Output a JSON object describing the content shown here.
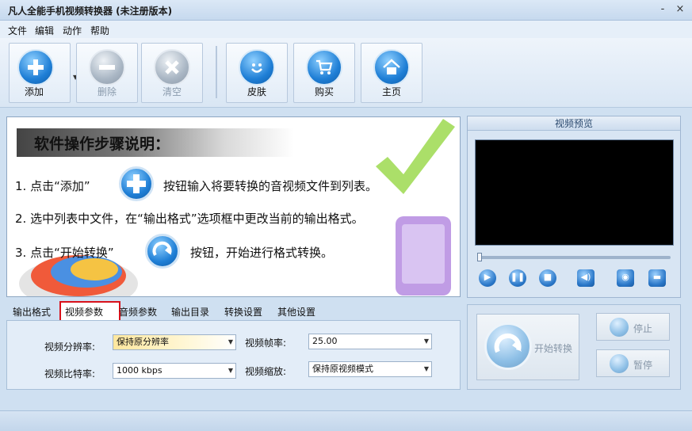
{
  "window": {
    "title": "凡人全能手机视频转换器  (未注册版本)",
    "minimize_glyph": "-",
    "close_glyph": "×"
  },
  "menu": [
    "文件",
    "编辑",
    "动作",
    "帮助"
  ],
  "toolbar": {
    "add": "添加",
    "delete": "删除",
    "clear": "清空",
    "skin": "皮肤",
    "buy": "购买",
    "home": "主页"
  },
  "banner": {
    "heading": "软件操作步骤说明：",
    "step1_a": "1. 点击“添加”",
    "step1_b": "按钮输入将要转换的音视频文件到列表。",
    "step2": "2. 选中列表中文件，在“输出格式”选项框中更改当前的输出格式。",
    "step3_a": "3. 点击“开始转换”",
    "step3_b": "按钮，开始进行格式转换。"
  },
  "preview": {
    "title": "视频预览"
  },
  "tabs": [
    "输出格式",
    "视频参数",
    "音频参数",
    "输出目录",
    "转换设置",
    "其他设置"
  ],
  "params": {
    "resolution_label": "视频分辨率:",
    "resolution_value": "保持原分辨率",
    "framerate_label": "视频帧率:",
    "framerate_value": "25.00",
    "bitrate_label": "视频比特率:",
    "bitrate_value": "1000 kbps",
    "scale_label": "视频缩放:",
    "scale_value": "保持原视频模式"
  },
  "actions": {
    "start": "开始转换",
    "stop": "停止",
    "pause": "暂停"
  },
  "colors": {
    "accent_blue": "#1f7fd6",
    "active_tab_border": "#d8111b"
  }
}
